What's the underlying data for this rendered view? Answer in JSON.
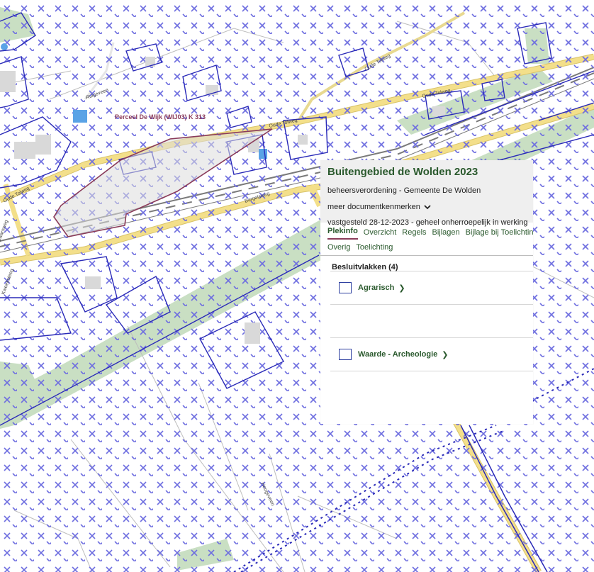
{
  "map": {
    "parcel_label": "Perceel De Wijk (WIJ03) K 313",
    "street_labels": [
      "Oude Tolweg",
      "Oude Tolweg",
      "Oude Tolweg",
      "Oude Tolweg",
      "Bargelsweg",
      "Ruigeveen",
      "Dwarsweg",
      "Kweeksteeg",
      "Hoogeveen"
    ],
    "colors": {
      "hatch": "#6f6fe0",
      "plan_outline": "#2a2ab8",
      "parcel_outline": "#8a3b5a",
      "road": "#f3df8a",
      "green_strip": "#c9dfc3",
      "water": "#5aa3e6",
      "building": "#d9d9d9",
      "railway": "#7a7a7a"
    }
  },
  "panel": {
    "title": "Buitengebied de Wolden 2023",
    "subtitle": "beheersverordening - Gemeente De Wolden",
    "more_label": "meer documentkenmerken",
    "status": "vastgesteld 28-12-2023 - geheel onherroepelijk in werking",
    "tabs_row1": [
      "Plekinfo",
      "Overzicht",
      "Regels",
      "Bijlagen",
      "Bijlage bij Toelichting"
    ],
    "tabs_row2": [
      "Overig",
      "Toelichting"
    ],
    "list_title": "Besluitvlakken (4)",
    "items": [
      "Agrarisch",
      "",
      "Waarde - Archeologie"
    ]
  }
}
